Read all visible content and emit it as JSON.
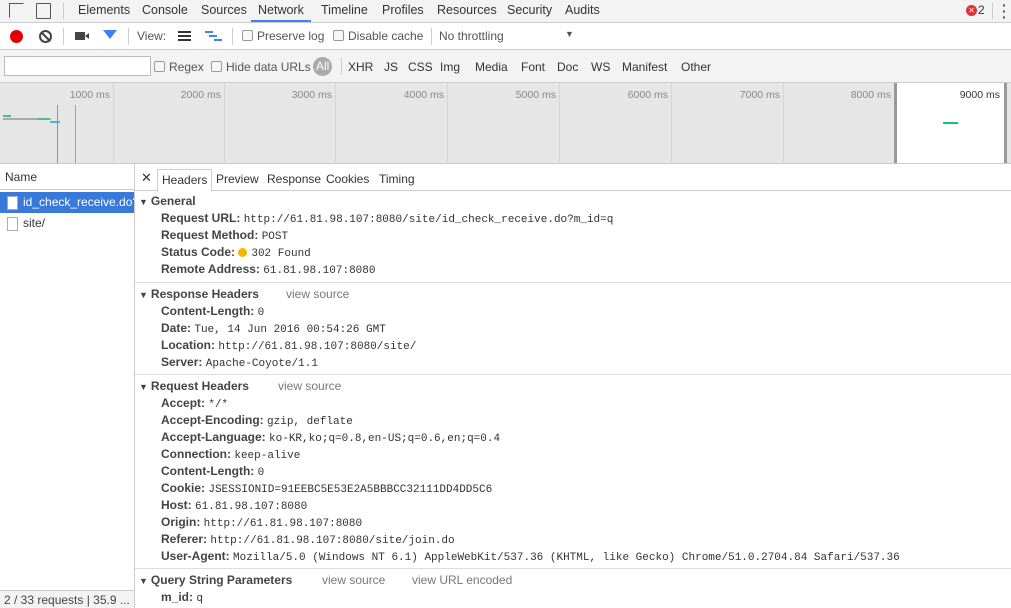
{
  "tabs": [
    "Elements",
    "Console",
    "Sources",
    "Network",
    "Timeline",
    "Profiles",
    "Resources",
    "Security",
    "Audits"
  ],
  "active_tab": "Network",
  "error_count": "2",
  "toolbar": {
    "view_label": "View:",
    "preserve_log": "Preserve log",
    "disable_cache": "Disable cache",
    "throttling": "No throttling"
  },
  "filter": {
    "value": "",
    "regex": "Regex",
    "hide_data_urls": "Hide data URLs",
    "types": [
      "All",
      "XHR",
      "JS",
      "CSS",
      "Img",
      "Media",
      "Font",
      "Doc",
      "WS",
      "Manifest",
      "Other"
    ]
  },
  "overview": {
    "ticks": [
      "1000 ms",
      "2000 ms",
      "3000 ms",
      "4000 ms",
      "5000 ms",
      "6000 ms",
      "7000 ms",
      "8000 ms",
      "9000 ms"
    ]
  },
  "requests": {
    "header": "Name",
    "items": [
      "id_check_receive.do?...",
      "site/"
    ],
    "selected": 0,
    "footer": "2 / 33 requests | 35.9 ..."
  },
  "detail": {
    "tabs": [
      "Headers",
      "Preview",
      "Response",
      "Cookies",
      "Timing"
    ],
    "active": "Headers",
    "view_source": "view source",
    "view_url_encoded": "view URL encoded",
    "general": {
      "title": "General",
      "rows": [
        {
          "k": "Request URL:",
          "v": "http://61.81.98.107:8080/site/id_check_receive.do?m_id=q"
        },
        {
          "k": "Request Method:",
          "v": "POST"
        },
        {
          "k": "Status Code:",
          "v": "302 Found"
        },
        {
          "k": "Remote Address:",
          "v": "61.81.98.107:8080"
        }
      ]
    },
    "response_headers": {
      "title": "Response Headers",
      "rows": [
        {
          "k": "Content-Length:",
          "v": "0"
        },
        {
          "k": "Date:",
          "v": "Tue, 14 Jun 2016 00:54:26 GMT"
        },
        {
          "k": "Location:",
          "v": "http://61.81.98.107:8080/site/"
        },
        {
          "k": "Server:",
          "v": "Apache-Coyote/1.1"
        }
      ]
    },
    "request_headers": {
      "title": "Request Headers",
      "rows": [
        {
          "k": "Accept:",
          "v": "*/*"
        },
        {
          "k": "Accept-Encoding:",
          "v": "gzip, deflate"
        },
        {
          "k": "Accept-Language:",
          "v": "ko-KR,ko;q=0.8,en-US;q=0.6,en;q=0.4"
        },
        {
          "k": "Connection:",
          "v": "keep-alive"
        },
        {
          "k": "Content-Length:",
          "v": "0"
        },
        {
          "k": "Cookie:",
          "v": "JSESSIONID=91EEBC5E53E2A5BBBCC32111DD4DD5C6"
        },
        {
          "k": "Host:",
          "v": "61.81.98.107:8080"
        },
        {
          "k": "Origin:",
          "v": "http://61.81.98.107:8080"
        },
        {
          "k": "Referer:",
          "v": "http://61.81.98.107:8080/site/join.do"
        },
        {
          "k": "User-Agent:",
          "v": "Mozilla/5.0 (Windows NT 6.1) AppleWebKit/537.36 (KHTML, like Gecko) Chrome/51.0.2704.84 Safari/537.36"
        }
      ]
    },
    "query": {
      "title": "Query String Parameters",
      "rows": [
        {
          "k": "m_id:",
          "v": "q"
        }
      ]
    }
  },
  "colors": {
    "accent": "#3e82f7",
    "selected_row": "#3879d9",
    "record": "#e30000",
    "status_dot": "#f2b800",
    "error": "#e0313a"
  }
}
